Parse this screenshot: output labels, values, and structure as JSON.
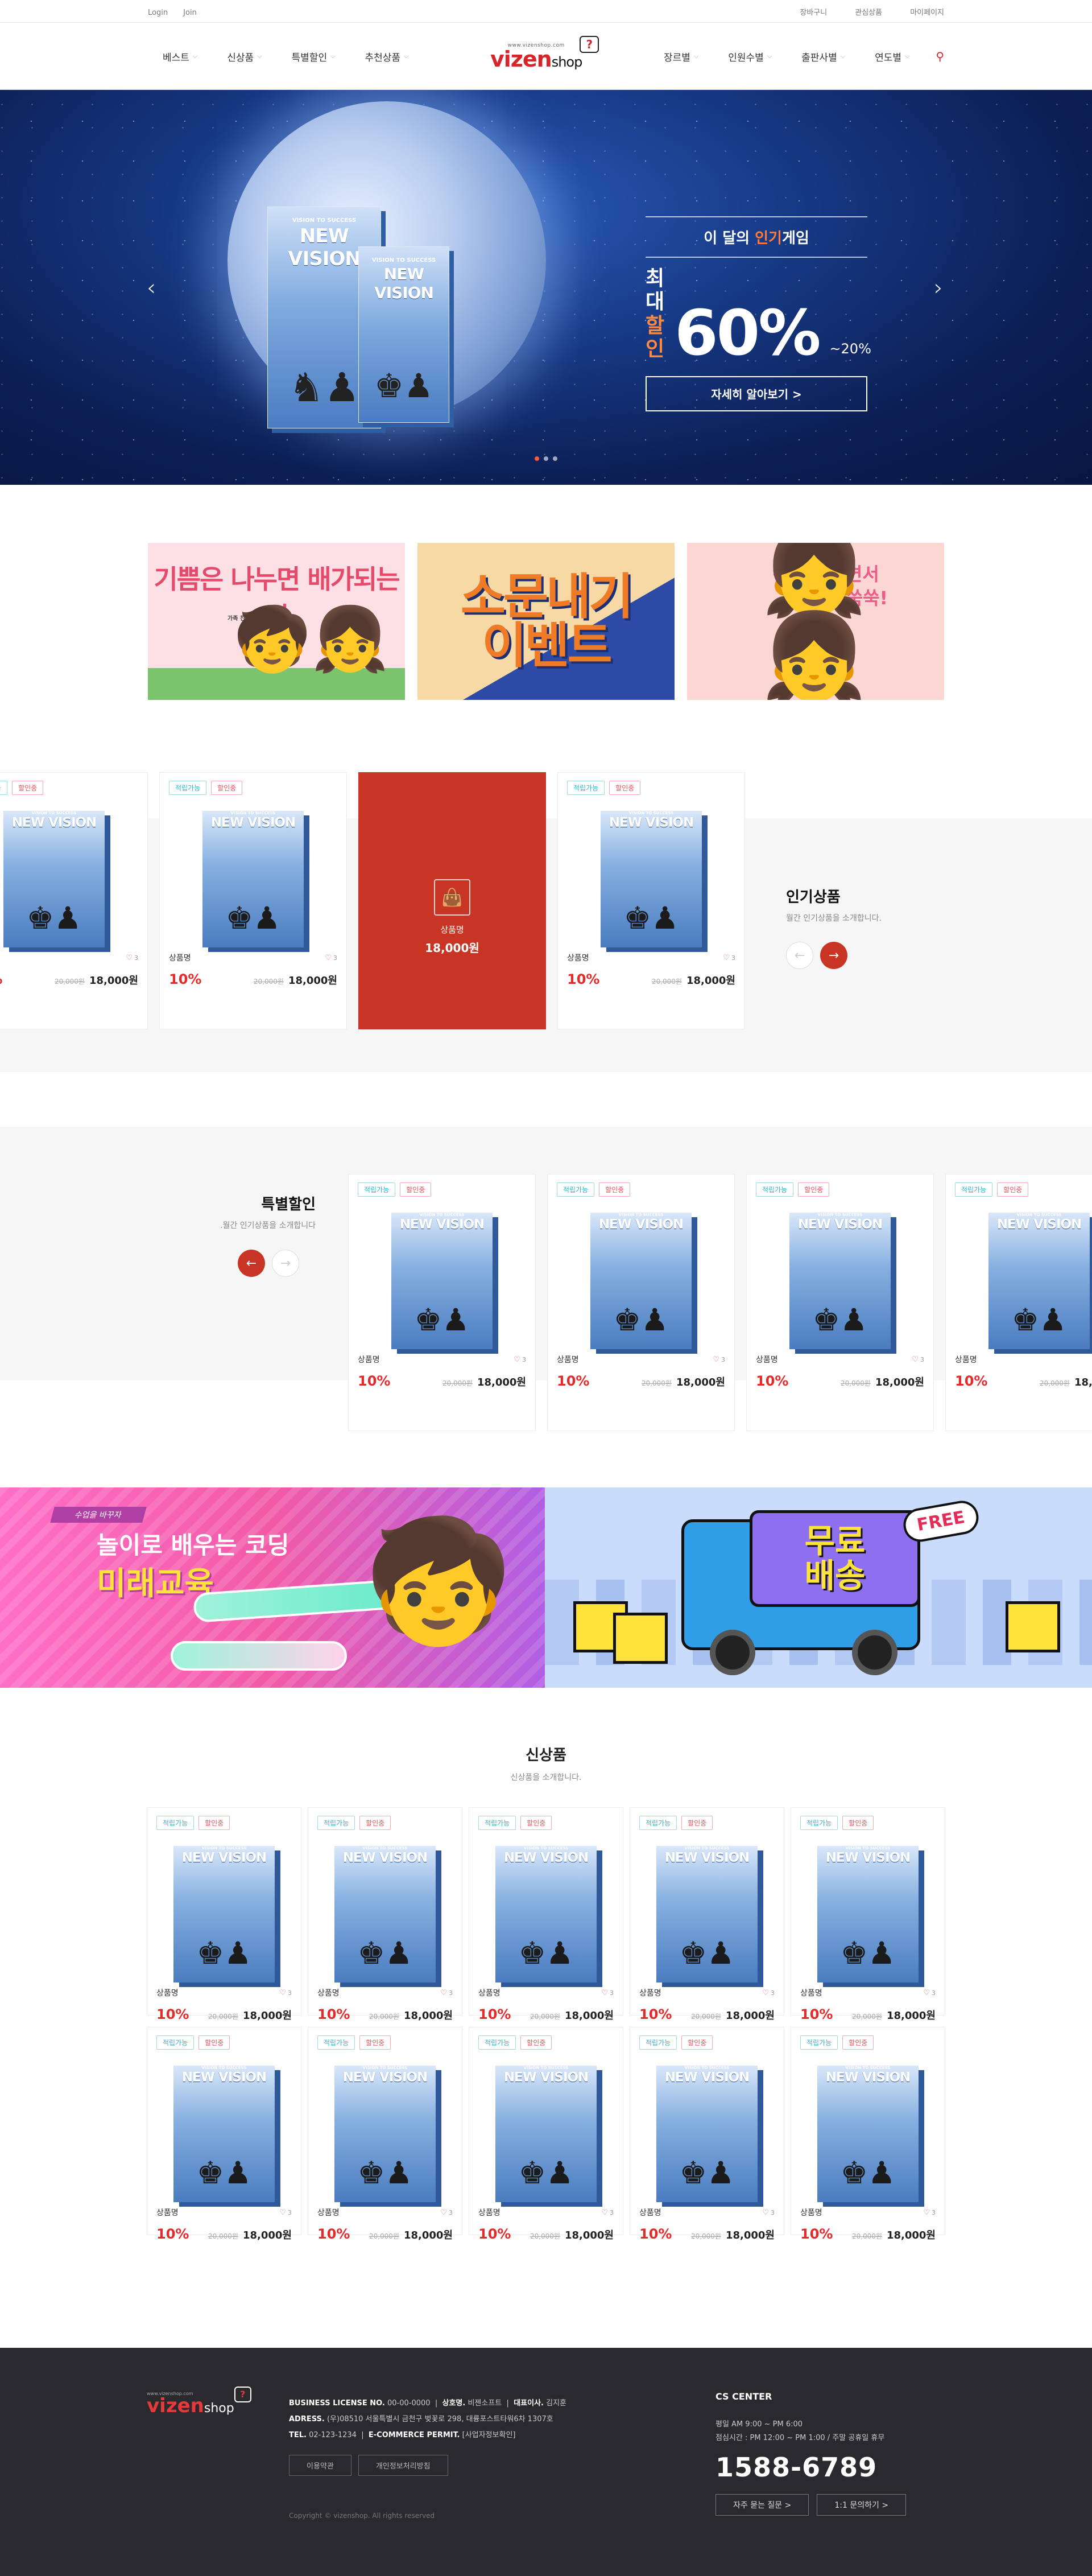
{
  "topbar": {
    "login": "Login",
    "join": "Join",
    "right": [
      "장바구니",
      "관심상품",
      "마이페이지"
    ]
  },
  "nav_left": [
    "베스트",
    "신상품",
    "특별할인",
    "추천상품"
  ],
  "nav_right": [
    "장르별",
    "인원수별",
    "출판사별",
    "연도별"
  ],
  "logo": {
    "tiny": "www.vizenshop.com",
    "mark": "vizen",
    "shop": "shop",
    "bubble": "?"
  },
  "hero": {
    "book_series": "VISION TO SUCCESS",
    "book_title": "NEW VISION",
    "headline_pre": "이 달의 ",
    "headline_em": "인기",
    "headline_post": "게임",
    "max_label_1": "최대",
    "max_label_2": "할인",
    "percent": "60%",
    "percent_small": "~20%",
    "more": "자세히 알아보기 >",
    "prev": "‹",
    "next": "›"
  },
  "promos": {
    "p1_text": "기쁨은 나누면 배가되는법",
    "p1_sub": "가족 친구와 함께하는 게임",
    "p2_text_1": "소문내기",
    "p2_text_2": "이벤트",
    "p3_text_1": "친구랑 놀면서",
    "p3_text_2": "EQ도 쑥쑥!"
  },
  "product": {
    "tag_a": "적립가능",
    "tag_b": "할인중",
    "name": "상품명",
    "likes": "3",
    "discount": "10%",
    "old_price": "20,000원",
    "price": "18,000원",
    "book_series": "VISION TO SUCCESS",
    "book_title": "NEW VISION"
  },
  "red_card": {
    "name": "상품명",
    "price": "18,000원"
  },
  "popular": {
    "title": "인기상품",
    "sub": "월간 인기상품을 소개합니다."
  },
  "special": {
    "title": "특별할인",
    "sub": "월간 인기상품을 소개합니다."
  },
  "banner_coding": {
    "label": "수업을 바꾸자",
    "t1": "놀이로 배우는 코딩",
    "t2": "미래교육"
  },
  "banner_ship": {
    "free": "FREE",
    "t1": "무료",
    "t2": "배송"
  },
  "new_products": {
    "title": "신상품",
    "sub": "신상품을 소개합니다."
  },
  "footer": {
    "license_label": "BUSINESS LICENSE NO.",
    "license": "00-00-0000",
    "company_label": "상호명.",
    "company": "비젠소프트",
    "ceo_label": "대표이사.",
    "ceo": "김지훈",
    "address_label": "ADRESS.",
    "address": "(우)08510 서울특별시 금천구 벚꽃로 298, 대륭포스트타워6차 1307호",
    "tel_label": "TEL.",
    "tel": "02-123-1234",
    "ecom_label": "E-COMMERCE PERMIT.",
    "ecom": "[사업자정보확인]",
    "btn_terms": "이용약관",
    "btn_privacy": "개인정보처리방침",
    "copyright": "Copyright © vizenshop. All rights reserved",
    "cs_title": "CS CENTER",
    "cs_hours_1": "평일 AM 9:00 ~ PM 6:00",
    "cs_hours_2": "점심시간 : PM 12:00 ~ PM 1:00 / 주말 공휴일 휴무",
    "cs_tel": "1588-6789",
    "faq": "자주 묻는 질문 >",
    "qna": "1:1 문의하기 >"
  }
}
